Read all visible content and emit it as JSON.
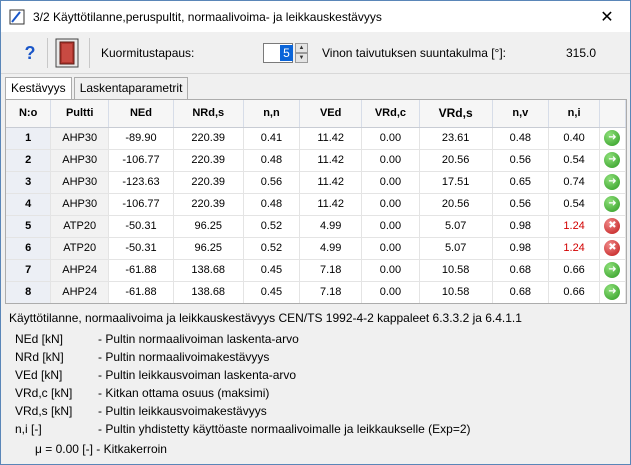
{
  "window": {
    "title": "3/2  Käyttötilanne,peruspultit, normaalivoima- ja leikkauskestävyys",
    "close": "✕"
  },
  "toolbar": {
    "help_label": "?",
    "kt_label": "Kuormitustapaus:",
    "kt_value": "5",
    "vino_label": "Vinon taivutuksen suuntakulma [°]:",
    "vino_value": "315.0"
  },
  "tabs": [
    "Kestävyys",
    "Laskentaparametrit"
  ],
  "table": {
    "headers": [
      "N:o",
      "Pultti",
      "NEd",
      "NRd,s",
      "n,n",
      "VEd",
      "VRd,c",
      "VRd,s",
      "n,v",
      "n,i",
      ""
    ],
    "rows": [
      [
        "1",
        "AHP30",
        "-89.90",
        "220.39",
        "0.41",
        "11.42",
        "0.00",
        "23.61",
        "0.48",
        "0.40",
        "ok"
      ],
      [
        "2",
        "AHP30",
        "-106.77",
        "220.39",
        "0.48",
        "11.42",
        "0.00",
        "20.56",
        "0.56",
        "0.54",
        "ok"
      ],
      [
        "3",
        "AHP30",
        "-123.63",
        "220.39",
        "0.56",
        "11.42",
        "0.00",
        "17.51",
        "0.65",
        "0.74",
        "ok"
      ],
      [
        "4",
        "AHP30",
        "-106.77",
        "220.39",
        "0.48",
        "11.42",
        "0.00",
        "20.56",
        "0.56",
        "0.54",
        "ok"
      ],
      [
        "5",
        "ATP20",
        "-50.31",
        "96.25",
        "0.52",
        "4.99",
        "0.00",
        "5.07",
        "0.98",
        "1.24",
        "fail"
      ],
      [
        "6",
        "ATP20",
        "-50.31",
        "96.25",
        "0.52",
        "4.99",
        "0.00",
        "5.07",
        "0.98",
        "1.24",
        "fail"
      ],
      [
        "7",
        "AHP24",
        "-61.88",
        "138.68",
        "0.45",
        "7.18",
        "0.00",
        "10.58",
        "0.68",
        "0.66",
        "ok"
      ],
      [
        "8",
        "AHP24",
        "-61.88",
        "138.68",
        "0.45",
        "7.18",
        "0.00",
        "10.58",
        "0.68",
        "0.66",
        "ok"
      ]
    ]
  },
  "legend": {
    "heading": "Käyttötilanne, normaalivoima ja leikkauskestävyys CEN/TS 1992-4-2 kappaleet 6.3.3.2 ja 6.4.1.1",
    "items": [
      {
        "key": "NEd [kN]",
        "desc": "- Pultin normaalivoiman laskenta-arvo"
      },
      {
        "key": "NRd [kN]",
        "desc": "- Pultin normaalivoimakestävyys"
      },
      {
        "key": "VEd [kN]",
        "desc": "- Pultin leikkausvoiman laskenta-arvo"
      },
      {
        "key": "VRd,c [kN]",
        "desc": "- Kitkan ottama osuus (maksimi)"
      },
      {
        "key": "VRd,s [kN]",
        "desc": "- Pultin leikkausvoimakestävyys"
      },
      {
        "key": "n,i [-]",
        "desc": "- Pultin yhdistetty käyttöaste normaalivoimalle ja leikkaukselle (Exp=2)"
      }
    ],
    "mu": "μ =  0.00 [-]   - Kitkakerroin"
  },
  "colors": {
    "ok": "#2e9a22",
    "fail": "#c01818",
    "bad_text": "#d20000",
    "selection": "#0a64d8"
  }
}
